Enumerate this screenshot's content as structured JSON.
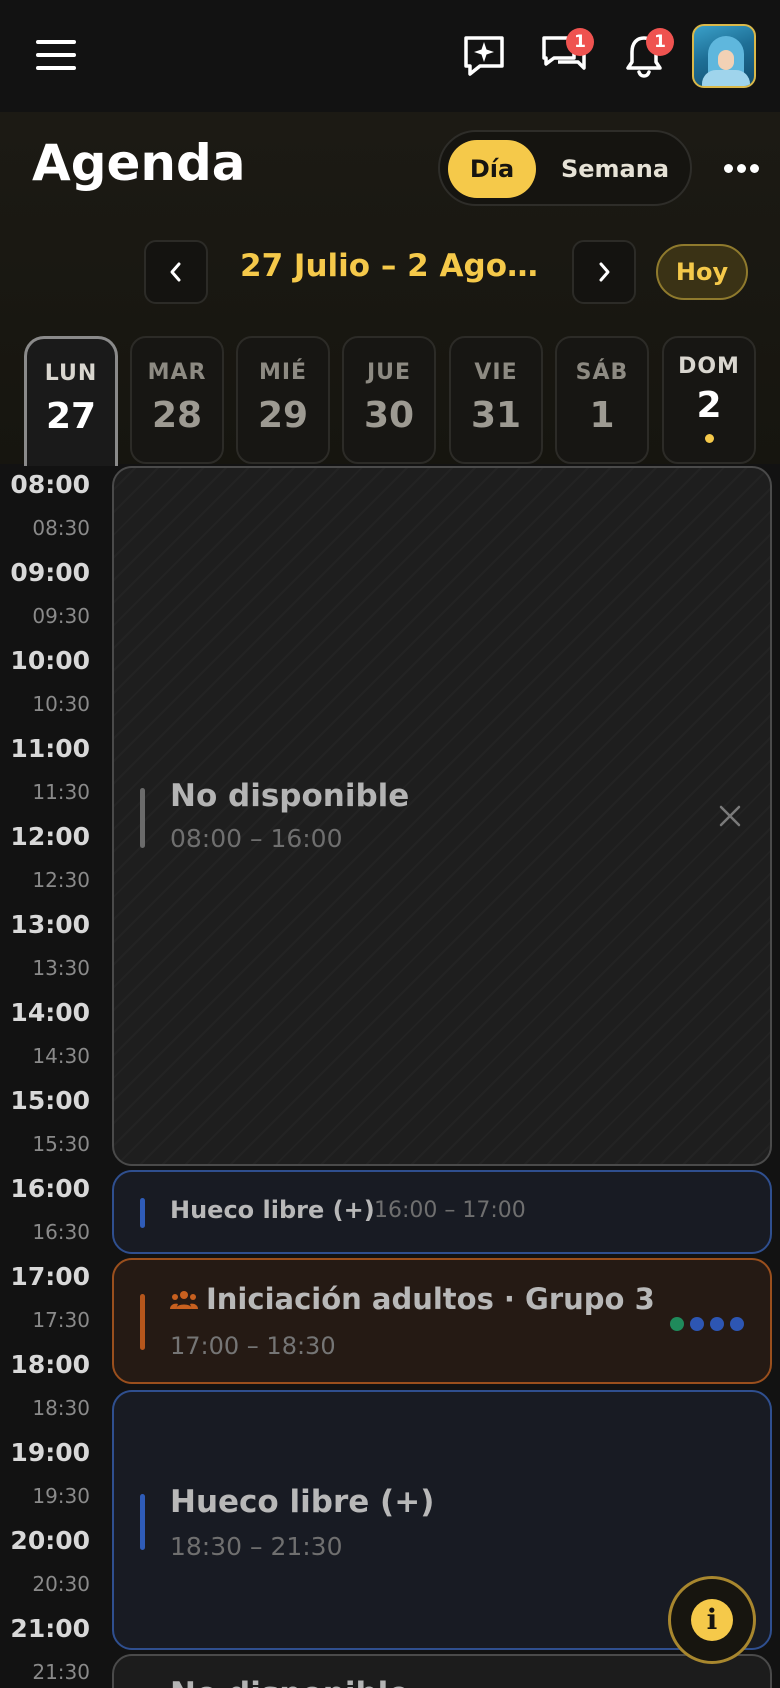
{
  "topbar": {
    "chat_badge": "1",
    "notifications_badge": "1",
    "icons": [
      "menu-icon",
      "sparkle-chat-icon",
      "messages-icon",
      "bell-icon"
    ]
  },
  "header": {
    "title": "Agenda",
    "view_day": "Día",
    "view_week": "Semana",
    "range": "27 Julio – 2 Agost…",
    "today": "Hoy"
  },
  "days": [
    {
      "dow": "LUN",
      "num": "27"
    },
    {
      "dow": "MAR",
      "num": "28"
    },
    {
      "dow": "MIÉ",
      "num": "29"
    },
    {
      "dow": "JUE",
      "num": "30"
    },
    {
      "dow": "VIE",
      "num": "31"
    },
    {
      "dow": "SÁB",
      "num": "1"
    },
    {
      "dow": "DOM",
      "num": "2"
    }
  ],
  "times": [
    "08:00",
    "08:30",
    "09:00",
    "09:30",
    "10:00",
    "10:30",
    "11:00",
    "11:30",
    "12:00",
    "12:30",
    "13:00",
    "13:30",
    "14:00",
    "14:30",
    "15:00",
    "15:30",
    "16:00",
    "16:30",
    "17:00",
    "17:30",
    "18:00",
    "18:30",
    "19:00",
    "19:30",
    "20:00",
    "20:30",
    "21:00",
    "21:30"
  ],
  "events": {
    "unavailable": {
      "title": "No disponible",
      "time": "08:00 – 16:00"
    },
    "free1": {
      "title": "Hueco libre (+)",
      "time": "16:00 – 17:00"
    },
    "class": {
      "title": "Iniciación adultos · Grupo 3",
      "time": "17:00 – 18:30"
    },
    "free2": {
      "title": "Hueco libre (+)",
      "time": "18:30 – 21:30"
    },
    "unavailable2": {
      "title": "No disponible"
    }
  },
  "colors": {
    "accent": "#f5c94a",
    "free": "#2f4f8f",
    "class": "#9a4f1d",
    "participant_dots": [
      "#1f8a5b",
      "#2d56b3",
      "#2d56b3",
      "#2d56b3"
    ]
  },
  "fab": {
    "label": "i"
  }
}
